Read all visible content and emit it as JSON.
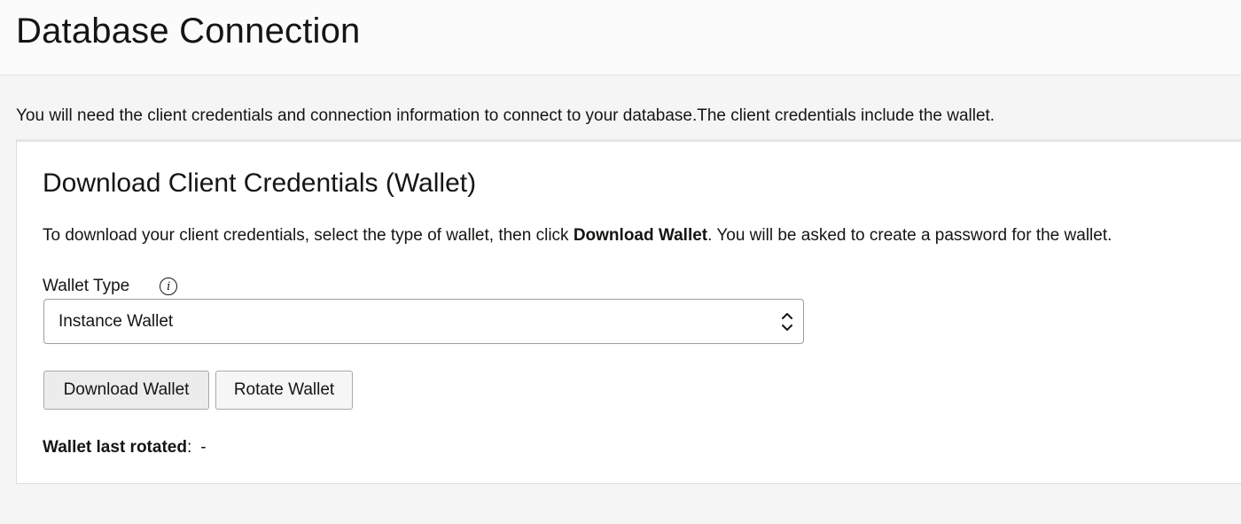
{
  "header": {
    "title": "Database Connection"
  },
  "intro": "You will need the client credentials and connection information to connect to your database.The client credentials include the wallet.",
  "panel": {
    "title": "Download Client Credentials (Wallet)",
    "instructions_before": "To download your client credentials, select the type of wallet, then click ",
    "instructions_bold": "Download Wallet",
    "instructions_after": ". You will be asked to create a password for the wallet.",
    "wallet_type": {
      "label": "Wallet Type",
      "info_icon": "info-icon",
      "info_glyph": "i",
      "selected": "Instance Wallet"
    },
    "buttons": {
      "download": "Download Wallet",
      "rotate": "Rotate Wallet"
    },
    "last_rotated": {
      "label": "Wallet last rotated",
      "separator": ":",
      "value": "-"
    }
  },
  "colors": {
    "page_background": "#f5f5f5",
    "text": "#161513",
    "panel_background": "#ffffff",
    "primary_button_background": "#ececec"
  }
}
